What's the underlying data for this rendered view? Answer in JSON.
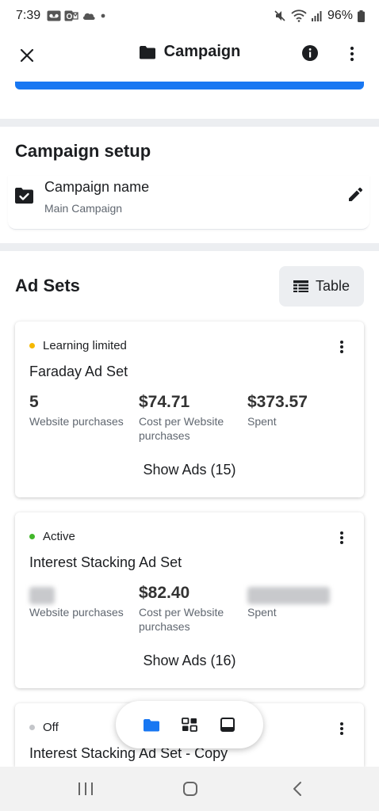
{
  "status_bar": {
    "time": "7:39",
    "battery": "96%"
  },
  "app_bar": {
    "title": "Campaign",
    "icons": [
      "close-icon",
      "folder-icon",
      "info-icon",
      "more-vert-icon"
    ]
  },
  "campaign_setup": {
    "heading": "Campaign setup",
    "field_label": "Campaign name",
    "field_value": "Main Campaign"
  },
  "ad_sets": {
    "heading": "Ad Sets",
    "table_button": "Table",
    "items": [
      {
        "status": "Learning limited",
        "status_color": "#f5b800",
        "name": "Faraday Ad Set",
        "metric1_value": "5",
        "metric1_label": "Website purchases",
        "metric2_value": "$74.71",
        "metric2_label": "Cost per Website purchases",
        "metric3_value": "$373.57",
        "metric3_label": "Spent",
        "show_ads": "Show Ads (15)"
      },
      {
        "status": "Active",
        "status_color": "#42b72a",
        "name": "Interest Stacking Ad Set",
        "metric1_label": "Website purchases",
        "metric2_value": "$82.40",
        "metric2_label": "Cost per Website purchases",
        "metric3_label": "Spent",
        "show_ads": "Show Ads (16)"
      },
      {
        "status": "Off",
        "status_color": "#c4c6ca",
        "name": "Interest Stacking Ad Set - Copy"
      }
    ]
  },
  "colors": {
    "accent": "#1877f2",
    "band": "#eceef1"
  }
}
